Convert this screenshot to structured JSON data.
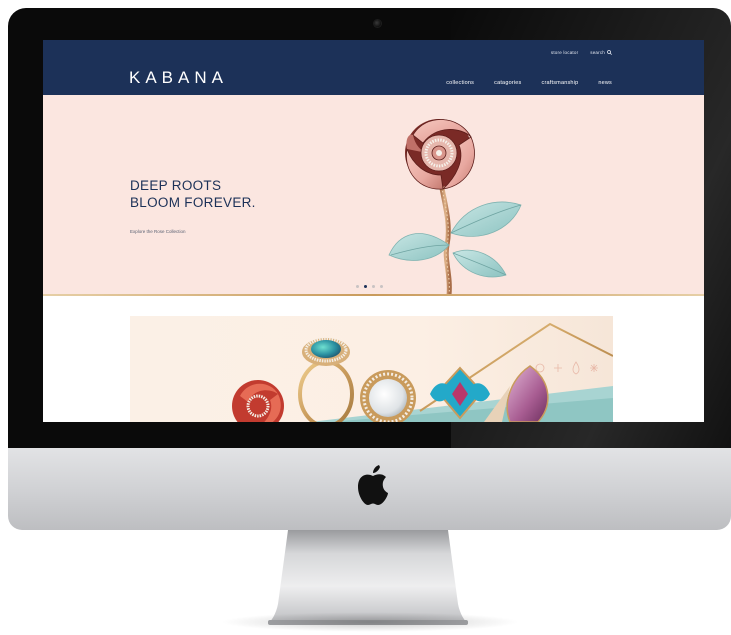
{
  "site": {
    "logo": "KABANA",
    "top_links": {
      "store_locator": "store locator",
      "search": "search"
    },
    "nav": {
      "collections": "collections",
      "categories": "catagories",
      "craftsmanship": "craftsmanship",
      "news": "news"
    }
  },
  "hero": {
    "headline_line1": "DEEP ROOTS",
    "headline_line2": "BLOOM FOREVER.",
    "cta": "Explore the Rose Collection",
    "slides": {
      "count": 4,
      "active": 2
    }
  },
  "icons": {
    "search": "search-icon",
    "apple": "apple-logo-icon",
    "camera": "camera-icon"
  },
  "colors": {
    "header_bg": "#1c3158",
    "hero_bg": "#fbe6e0",
    "headline": "#1c3158",
    "accent_gold": "#c99b5c",
    "leaf_teal": "#a8d4d2",
    "rose_pink": "#e8a8a0"
  }
}
